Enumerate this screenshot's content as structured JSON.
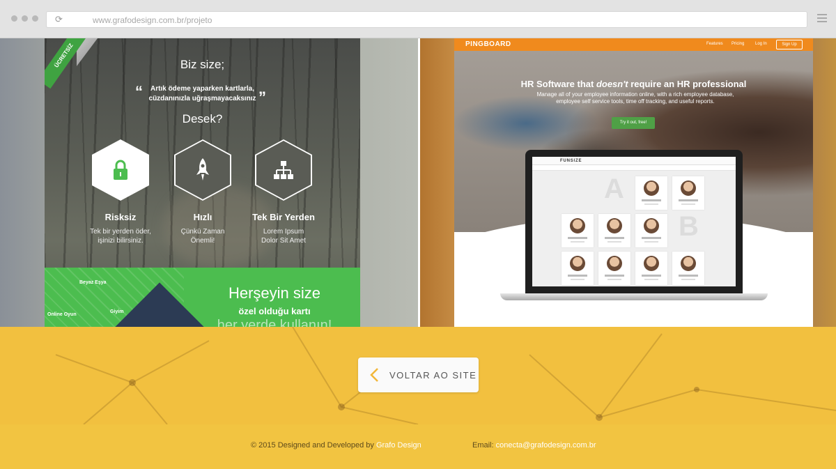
{
  "browser": {
    "url": "www.grafodesign.com.br/projeto"
  },
  "left_project": {
    "ribbon": "ÜCRETSİZ",
    "heading": "Biz size;",
    "quote": [
      "Artık ödeme yaparken kartlarla,",
      "cüzdanınızla uğraşmayacaksınız"
    ],
    "subheading": "Desek?",
    "features": [
      {
        "icon": "lock-icon",
        "title": "Risksiz",
        "desc": [
          "Tek bir yerden öder,",
          "işinizi bilirsiniz."
        ]
      },
      {
        "icon": "rocket-icon",
        "title": "Hızlı",
        "desc": [
          "Çünkü Zaman",
          "Önemli!"
        ]
      },
      {
        "icon": "sitemap-icon",
        "title": "Tek Bir Yerden",
        "desc": [
          "Lorem Ipsum",
          "Dolor Sit Amet"
        ]
      }
    ],
    "green": {
      "line1": "Herşeyin size",
      "line2": "özel olduğu kartı",
      "line3": "her yerde kullanın!",
      "labels": [
        "Beyaz Eşya",
        "Giyim",
        "Online Oyun"
      ]
    }
  },
  "right_project": {
    "brand": "PINGBOARD",
    "nav": [
      "Features",
      "Pricing",
      "Log In"
    ],
    "signup": "Sign Up",
    "hero_title_pre": "HR Software that ",
    "hero_title_em": "doesn't",
    "hero_title_post": " require an HR professional",
    "hero_sub": "Manage all of your employee information online, with a rich employee database, employee self service tools, time off tracking, and useful reports.",
    "hero_button": "Try it out, free!",
    "app_logo": "FUNSIZE",
    "letters": [
      "A",
      "B"
    ]
  },
  "back_button": {
    "label": "VOLTAR AO SITE"
  },
  "footer": {
    "copy_prefix": "© 2015 Designed and Developed by ",
    "copy_link": "Grafo Design",
    "email_prefix": "Email: ",
    "email_link": "conecta@grafodesign.com.br"
  },
  "colors": {
    "accent_yellow": "#f2c03f",
    "green": "#4cbd4f",
    "pingboard_orange": "#f08a1d"
  }
}
